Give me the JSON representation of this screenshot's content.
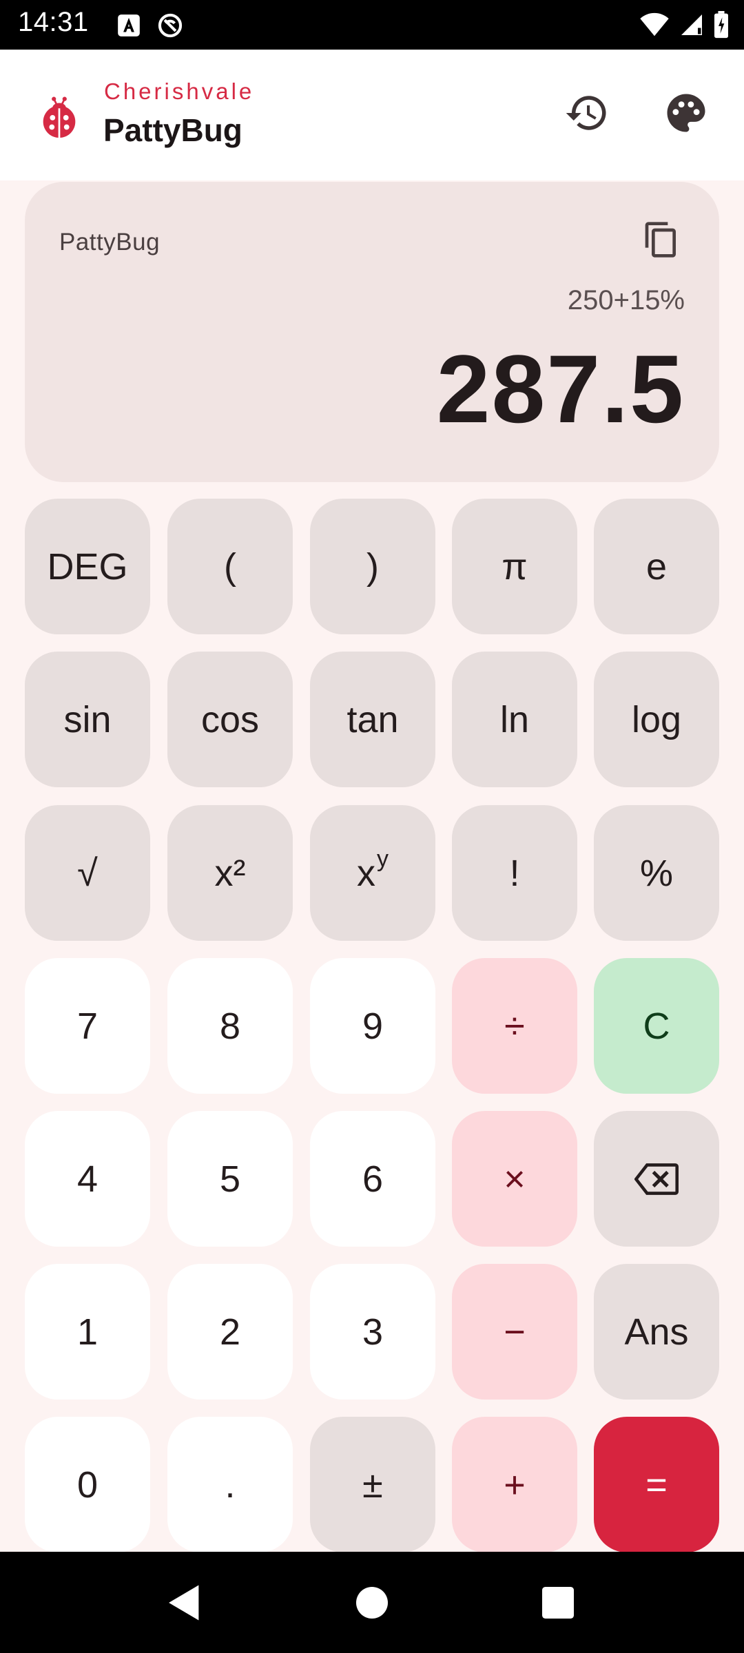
{
  "status": {
    "time": "14:31"
  },
  "app": {
    "brand": "Cherishvale",
    "title": "PattyBug"
  },
  "display": {
    "label": "PattyBug",
    "expression": "250+15%",
    "result": "287.5"
  },
  "keys": {
    "deg": "DEG",
    "lparen": "(",
    "rparen": ")",
    "pi": "π",
    "e": "e",
    "sin": "sin",
    "cos": "cos",
    "tan": "tan",
    "ln": "ln",
    "log": "log",
    "sqrt": "√",
    "square": "x²",
    "power_base": "x",
    "power_exp": "y",
    "factorial": "!",
    "percent": "%",
    "seven": "7",
    "eight": "8",
    "nine": "9",
    "divide": "÷",
    "clear": "C",
    "four": "4",
    "five": "5",
    "six": "6",
    "multiply": "×",
    "one": "1",
    "two": "2",
    "three": "3",
    "minus": "−",
    "ans": "Ans",
    "zero": "0",
    "dot": ".",
    "plusminus": "±",
    "plus": "+",
    "equals": "="
  },
  "colors": {
    "accent": "#d7243f",
    "clear_key": "#c5ebcd",
    "operator_key": "#fdd8dc",
    "function_key": "#e7dedd"
  },
  "icons": [
    "history-icon",
    "palette-icon",
    "copy-icon",
    "backspace-icon",
    "ladybug-logo-icon"
  ]
}
